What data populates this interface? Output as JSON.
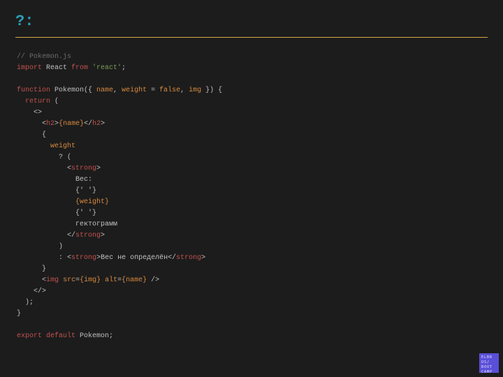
{
  "header": {
    "title": "?:"
  },
  "code": {
    "l1_comment": "// Pokemon.js",
    "l2_kw_import": "import",
    "l2_mod": " React ",
    "l2_kw_from": "from",
    "l2_str": " 'react'",
    "l2_semi": ";",
    "l4_kw_function": "function",
    "l4_fn": " Pokemon({ ",
    "l4_p1": "name",
    "l4_c1": ", ",
    "l4_p2": "weight",
    "l4_eq": " = ",
    "l4_false": "false",
    "l4_c2": ", ",
    "l4_p3": "img",
    "l4_tail": " }) {",
    "l5_kw_return": "return",
    "l5_paren": " (",
    "l6_ind": "    ",
    "l6_lt": "<",
    "l6_gt": ">",
    "l7_ind": "      ",
    "l7_lt": "<",
    "l7_tag": "h2",
    "l7_gt": ">",
    "l7_expr": "{name}",
    "l7_clt": "</",
    "l7_ctag": "h2",
    "l7_cgt": ">",
    "l8_ind": "      ",
    "l8": "{",
    "l9_ind": "        ",
    "l9": "weight",
    "l10_ind": "          ",
    "l10": "? (",
    "l11_ind": "            ",
    "l11_lt": "<",
    "l11_tag": "strong",
    "l11_gt": ">",
    "l12_ind": "              ",
    "l12": "Вес:",
    "l13_ind": "              ",
    "l13": "{' '}",
    "l14_ind": "              ",
    "l14": "{weight}",
    "l15_ind": "              ",
    "l15": "{' '}",
    "l16_ind": "              ",
    "l16": "гектограмм",
    "l17_ind": "            ",
    "l17_clt": "</",
    "l17_tag": "strong",
    "l17_gt": ">",
    "l18_ind": "          ",
    "l18": ")",
    "l19_ind": "          ",
    "l19_colon": ": ",
    "l19_lt": "<",
    "l19_tag": "strong",
    "l19_gt": ">",
    "l19_txt": "Вес не определён",
    "l19_clt": "</",
    "l19_ctag": "strong",
    "l19_cgt": ">",
    "l20_ind": "      ",
    "l20": "}",
    "l21_ind": "      ",
    "l21_lt": "<",
    "l21_tag": "img",
    "l21_sp1": " ",
    "l21_a1": "src",
    "l21_eq1": "=",
    "l21_v1": "{img}",
    "l21_sp2": " ",
    "l21_a2": "alt",
    "l21_eq2": "=",
    "l21_v2": "{name}",
    "l21_close": " />",
    "l22_ind": "    ",
    "l22_clt": "</",
    "l22_gt": ">",
    "l23_ind": "  ",
    "l23": ");",
    "l24": "}",
    "l26_kw_export": "export",
    "l26_sp": " ",
    "l26_kw_default": "default",
    "l26_tail": " Pokemon;"
  },
  "badge": {
    "l1": "ELBR",
    "l2": "US/",
    "l3": "BOOT",
    "l4": "CAMP"
  }
}
